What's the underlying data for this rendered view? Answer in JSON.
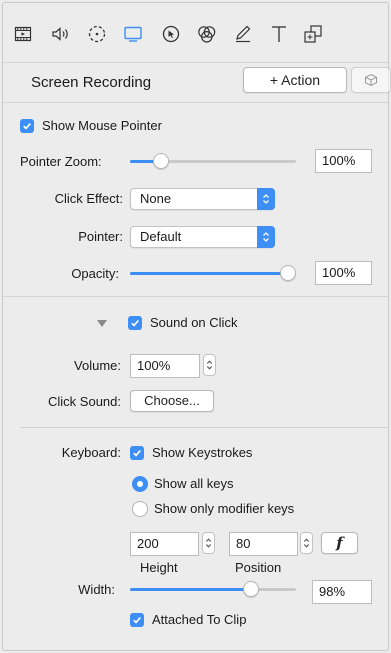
{
  "toolbar": {
    "items": [
      {
        "icon": "film-icon"
      },
      {
        "icon": "audio-icon"
      },
      {
        "icon": "animation-icon"
      },
      {
        "icon": "screen-icon",
        "active": true
      },
      {
        "icon": "cursor-icon"
      },
      {
        "icon": "filters-icon"
      },
      {
        "icon": "annotation-icon"
      },
      {
        "icon": "text-icon"
      },
      {
        "icon": "layout-icon"
      }
    ]
  },
  "header": {
    "title": "Screen Recording",
    "add_action": "+ Action"
  },
  "pointer": {
    "show_label": "Show Mouse Pointer",
    "show_checked": true,
    "zoom_label": "Pointer Zoom:",
    "zoom_value": "100%",
    "zoom_fraction": 0.15,
    "click_effect_label": "Click Effect:",
    "click_effect_value": "None",
    "pointer_label": "Pointer:",
    "pointer_value": "Default",
    "opacity_label": "Opacity:",
    "opacity_value": "100%",
    "opacity_fraction": 1.0
  },
  "sound": {
    "sound_on_click_label": "Sound on Click",
    "sound_on_click_checked": true,
    "volume_label": "Volume:",
    "volume_value": "100%",
    "click_sound_label": "Click Sound:",
    "choose_button": "Choose..."
  },
  "keyboard": {
    "label": "Keyboard:",
    "show_keystrokes_label": "Show Keystrokes",
    "show_keystrokes_checked": true,
    "radio_all_label": "Show all keys",
    "radio_modifier_label": "Show only modifier keys",
    "selected_radio": "all",
    "height_value": "200",
    "position_value": "80",
    "height_caption": "Height",
    "position_caption": "Position",
    "font_button": "f",
    "width_label": "Width:",
    "width_value": "98%",
    "width_fraction": 0.75,
    "attached_label": "Attached To Clip",
    "attached_checked": true
  },
  "colors": {
    "accent": "#3d8ff5",
    "background": "#ececec"
  }
}
